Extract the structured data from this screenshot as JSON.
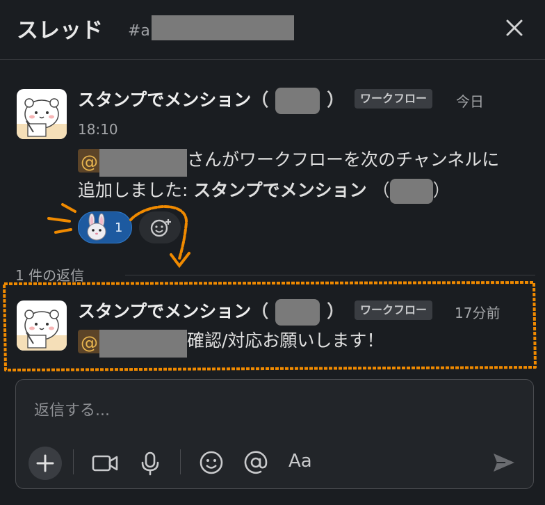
{
  "header": {
    "title": "スレッド",
    "channel_prefix": "#a",
    "close_icon": "close-icon"
  },
  "messages": [
    {
      "sender": "スタンプでメンション",
      "badge": "ワークフロー",
      "time_inline": "今日",
      "time_line": "18:10",
      "mention_at": "@",
      "body_line1_suffix": "さんがワークフローを次のチャンネルに",
      "body_line2_prefix": "追加しました: ",
      "body_line2_bold": "スタンプでメンション",
      "reaction": {
        "emoji": "rabbit-face",
        "count": "1"
      }
    },
    {
      "sender": "スタンプでメンション",
      "badge": "ワークフロー",
      "time_inline": "17分前",
      "mention_at": "@",
      "body_suffix": "確認/対応お願いします！"
    }
  ],
  "thread": {
    "reply_count_label": "1 件の返信"
  },
  "composer": {
    "placeholder": "返信する...",
    "format_label": "Aa",
    "icons": [
      "plus-icon",
      "video-icon",
      "microphone-icon",
      "emoji-icon",
      "at-icon",
      "send-icon"
    ]
  },
  "colors": {
    "background": "#1a1d21",
    "highlight_orange": "#f08a00",
    "reaction_blue": "#1d5aa0",
    "mention_bg": "#5c4428",
    "mention_fg": "#e8b54f"
  }
}
